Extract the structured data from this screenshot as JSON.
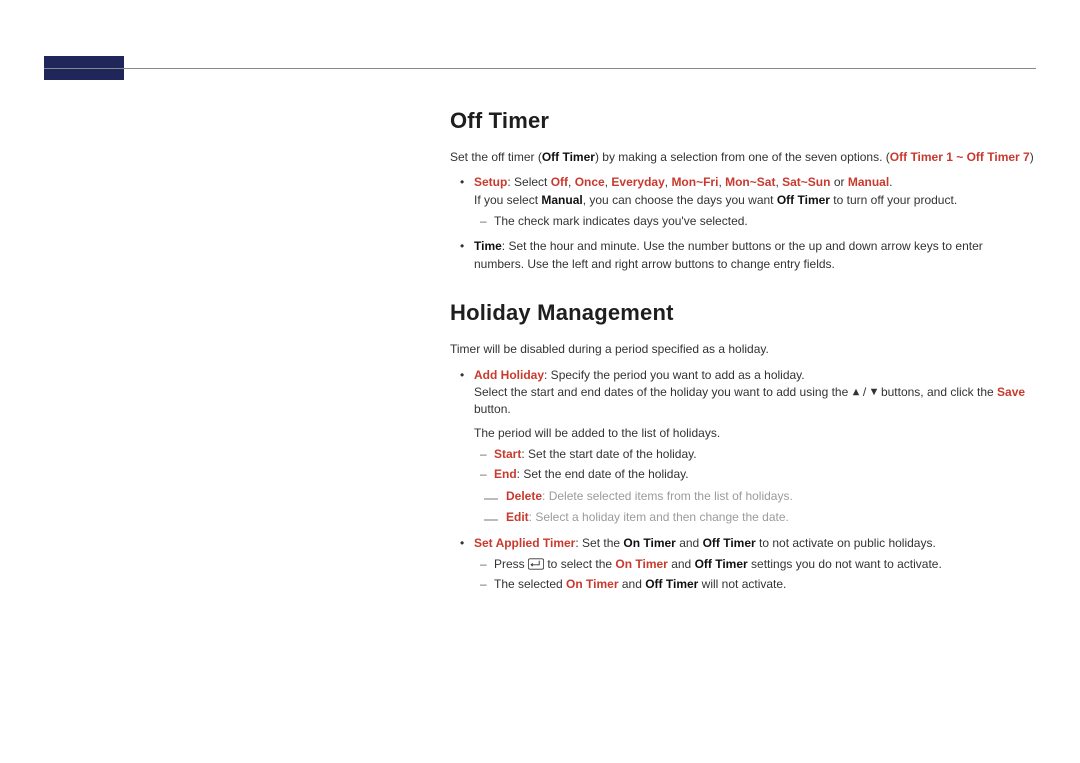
{
  "offTimer": {
    "heading": "Off Timer",
    "intro_pre": "Set the off timer (",
    "intro_bold1": "Off Timer",
    "intro_mid": ") by making a selection from one of the seven options. (",
    "intro_red": "Off Timer 1 ~ Off Timer 7",
    "intro_post": ")",
    "setup": {
      "label": "Setup",
      "sep": ": Select ",
      "opt1": "Off",
      "c1": ", ",
      "opt2": "Once",
      "c2": ", ",
      "opt3": "Everyday",
      "c3": ", ",
      "opt4": "Mon~Fri",
      "c4": ", ",
      "opt5": "Mon~Sat",
      "c5": ", ",
      "opt6": "Sat~Sun",
      "or": " or ",
      "opt7": "Manual",
      "tail": ".",
      "line2_pre": "If you select ",
      "line2_kw1": "Manual",
      "line2_mid": ", you can choose the days you want ",
      "line2_kw2": "Off Timer",
      "line2_post": " to turn off your product.",
      "sub1": "The check mark indicates days you've selected."
    },
    "time": {
      "label": "Time",
      "text": ": Set the hour and minute. Use the number buttons or the up and down arrow keys to enter numbers. Use the left and right arrow buttons to change entry fields."
    }
  },
  "holiday": {
    "heading": "Holiday Management",
    "intro": "Timer will be disabled during a period specified as a holiday.",
    "add": {
      "label": "Add Holiday",
      "line1": ": Specify the period you want to add as a holiday.",
      "line2_pre": "Select the start and end dates of the holiday you want to add using the ",
      "line2_post": " buttons, and click the ",
      "line2_save": "Save",
      "line2_tail": " button.",
      "line3": "The period will be added to the list of holidays.",
      "start_label": "Start",
      "start_text": ": Set the start date of the holiday.",
      "end_label": "End",
      "end_text": ": Set the end date of the holiday."
    },
    "delete": {
      "label": "Delete",
      "text": ": Delete selected items from the list of holidays."
    },
    "edit": {
      "label": "Edit",
      "text": ": Select a holiday item and then change the date."
    },
    "applied": {
      "label": "Set Applied Timer",
      "pre": ": Set the ",
      "on": "On Timer",
      "and1": " and ",
      "off": "Off Timer",
      "post": " to not activate on public holidays.",
      "press_pre": "Press ",
      "press_mid": " to select the ",
      "press_on": "On Timer",
      "press_and": " and ",
      "press_off": "Off Timer",
      "press_post": " settings you do not want to activate.",
      "sel_pre": "The selected ",
      "sel_on": "On Timer",
      "sel_and": " and ",
      "sel_off": "Off Timer",
      "sel_post": " will not activate."
    }
  },
  "triangles_sep": " / "
}
